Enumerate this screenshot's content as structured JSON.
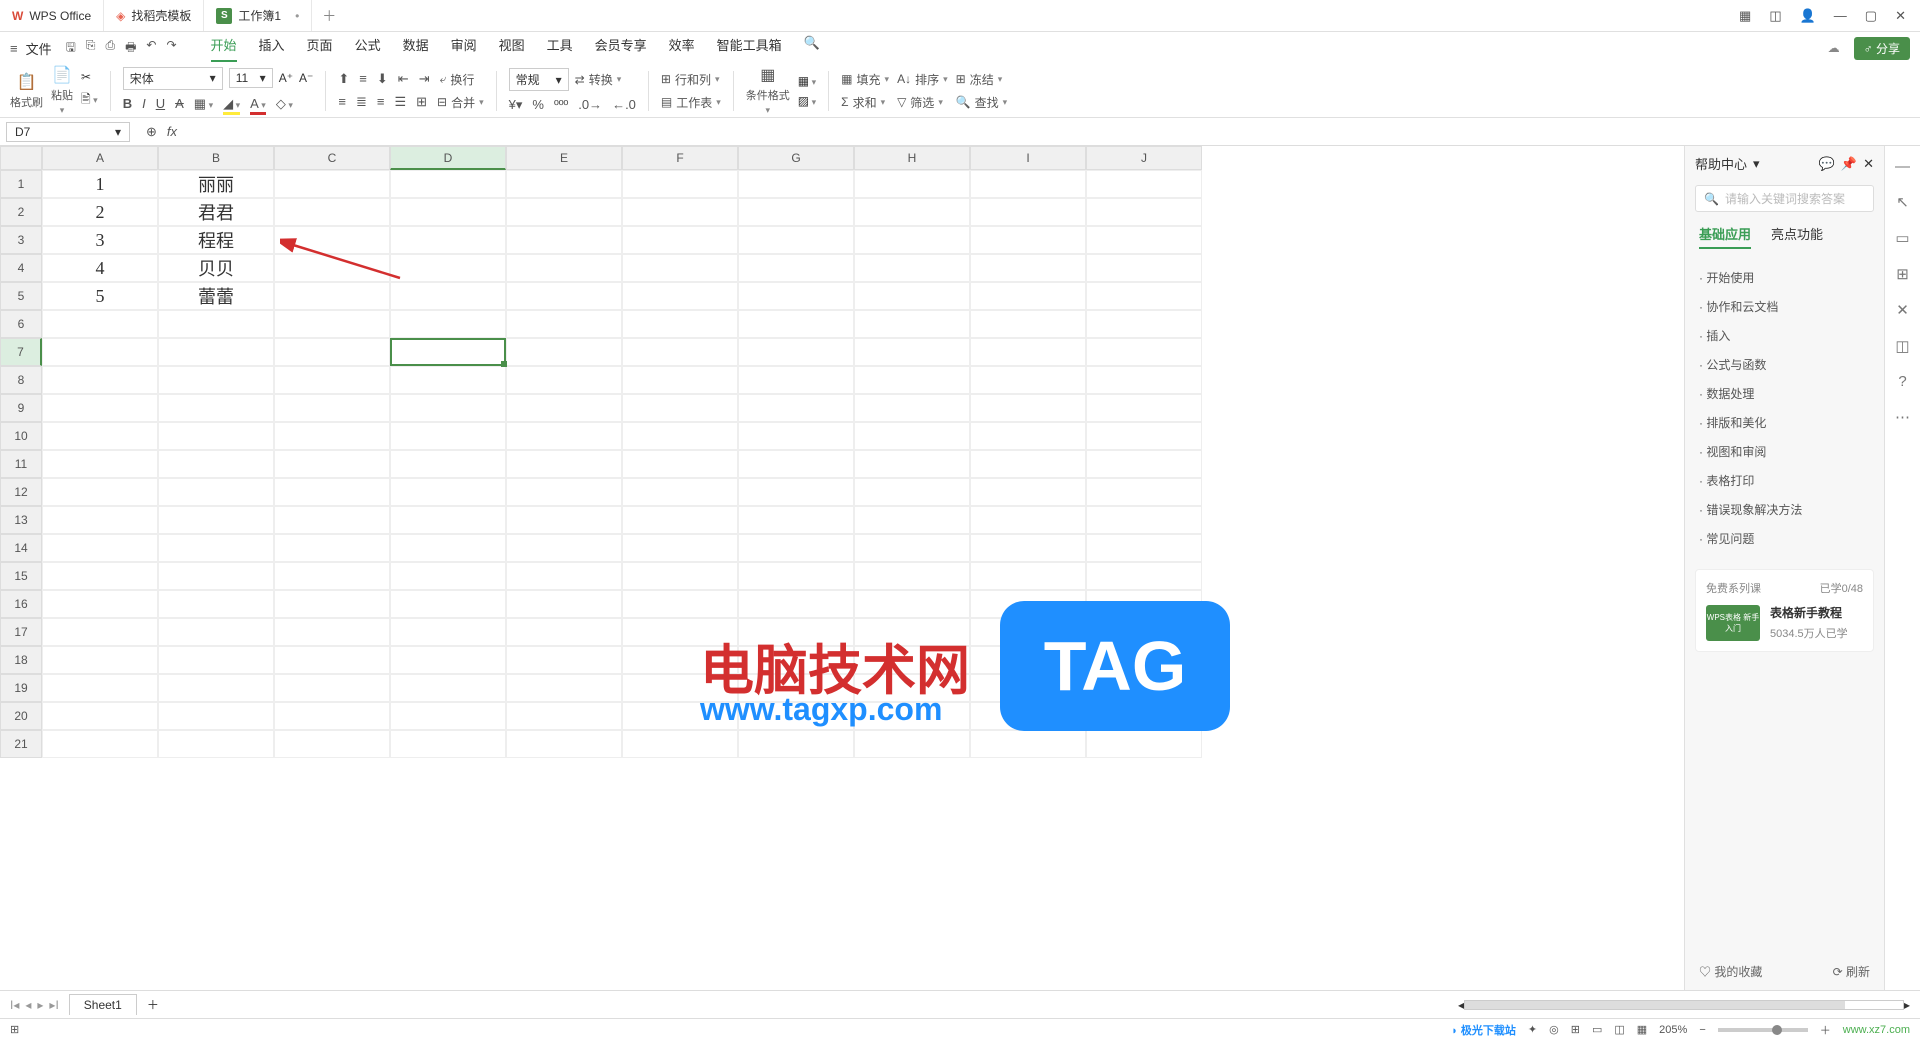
{
  "titlebar": {
    "tabs": [
      {
        "icon": "W",
        "label": "WPS Office"
      },
      {
        "icon": "D",
        "label": "找稻壳模板"
      },
      {
        "icon": "S",
        "label": "工作簿1",
        "active": true
      }
    ]
  },
  "menubar": {
    "file": "文件",
    "tabs": [
      "开始",
      "插入",
      "页面",
      "公式",
      "数据",
      "审阅",
      "视图",
      "工具",
      "会员专享",
      "效率",
      "智能工具箱"
    ],
    "active": "开始",
    "share": "分享"
  },
  "ribbon": {
    "format_painter": "格式刷",
    "paste": "粘贴",
    "font_name": "宋体",
    "font_size": "11",
    "wrap": "换行",
    "merge": "合并",
    "general": "常规",
    "convert": "转换",
    "rowcol": "行和列",
    "worksheet": "工作表",
    "cond_fmt": "条件格式",
    "fill": "填充",
    "sort": "排序",
    "freeze": "冻结",
    "sum": "求和",
    "filter": "筛选",
    "find": "查找"
  },
  "fxbar": {
    "cell_ref": "D7",
    "formula": ""
  },
  "grid": {
    "columns": [
      "A",
      "B",
      "C",
      "D",
      "E",
      "F",
      "G",
      "H",
      "I",
      "J"
    ],
    "row_count": 21,
    "data": {
      "r1": {
        "A": "1",
        "B": "丽丽"
      },
      "r2": {
        "A": "2",
        "B": "君君"
      },
      "r3": {
        "A": "3",
        "B": "程程"
      },
      "r4": {
        "A": "4",
        "B": "贝贝"
      },
      "r5": {
        "A": "5",
        "B": "蕾蕾"
      }
    },
    "selected": {
      "row": 7,
      "col": "D"
    }
  },
  "help": {
    "title": "帮助中心",
    "search_placeholder": "请输入关键词搜索答案",
    "tabs": [
      "基础应用",
      "亮点功能"
    ],
    "active_tab": "基础应用",
    "items": [
      "开始使用",
      "协作和云文档",
      "插入",
      "公式与函数",
      "数据处理",
      "排版和美化",
      "视图和审阅",
      "表格打印",
      "错误现象解决方法",
      "常见问题"
    ],
    "course_header": "免费系列课",
    "course_progress": "已学0/48",
    "course_thumb": "WPS表格\n新手入门",
    "course_title": "表格新手教程",
    "course_sub": "5034.5万人已学",
    "favs": "我的收藏",
    "refresh": "刷新"
  },
  "sheettabs": {
    "sheet": "Sheet1"
  },
  "statusbar": {
    "zoom": "205%"
  },
  "watermark": {
    "text1": "电脑技术网",
    "url": "www.tagxp.com",
    "tag": "TAG",
    "dl_site": "极光下载站",
    "dl_url": "www.xz7.com"
  }
}
